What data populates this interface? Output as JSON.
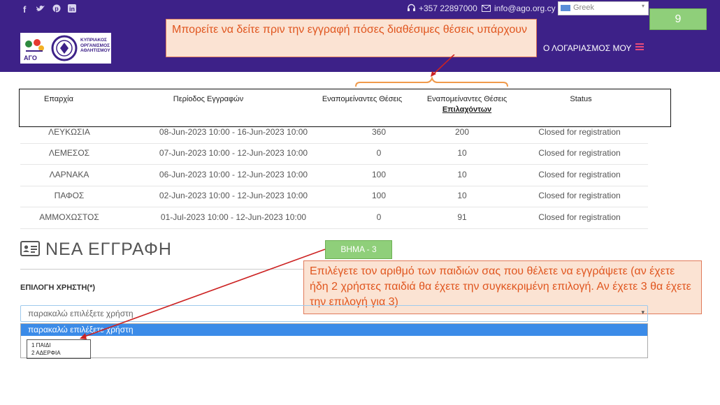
{
  "header": {
    "phone": "+357 22897000",
    "email": "info@ago.org.cy",
    "language": "Greek",
    "account_label": "Ο ΛΟΓΑΡΙΑΣΜΟΣ ΜΟΥ",
    "logo_left_text": "AΓO",
    "logo_right_text": "ΚΥΠΡΙΑΚΟΣ ΟΡΓΑΝΙΣΜΟΣ ΑΘΛΗΤΙΣΜΟΥ"
  },
  "slide_number": "9",
  "callout_top": "Μπορείτε να δείτε πριν την εγγραφή πόσες διαθέσιμες θέσεις υπάρχουν",
  "step_label": "ΒΗΜΑ - 3",
  "callout_step": "Επιλέγετε τον αριθμό των παιδιών σας που θέλετε να εγγράψετε (αν έχετε ήδη 2 χρήστες παιδιά θα έχετε την συγκεκριμένη επιλογή. Αν έχετε 3 θα έχετε την επιλογή για 3)",
  "table": {
    "headers": [
      "Επαρχία",
      "Περίοδος Εγγραφών",
      "Εναπομείναντες Θέσεις",
      "Εναπομείναντες Θέσεις",
      "Επιλαχόντων",
      "Status"
    ],
    "rows": [
      [
        "ΛΕΥΚΩΣΙΑ",
        "08-Jun-2023 10:00 - 16-Jun-2023 10:00",
        "360",
        "200",
        "Closed for registration"
      ],
      [
        "ΛΕΜΕΣΟΣ",
        "07-Jun-2023 10:00 - 12-Jun-2023 10:00",
        "0",
        "10",
        "Closed for registration"
      ],
      [
        "ΛΑΡΝΑΚΑ",
        "06-Jun-2023 10:00 - 12-Jun-2023 10:00",
        "100",
        "10",
        "Closed for registration"
      ],
      [
        "ΠΑΦΟΣ",
        "02-Jun-2023 10:00 - 12-Jun-2023 10:00",
        "100",
        "10",
        "Closed for registration"
      ],
      [
        "ΑΜΜΟΧΩΣΤΟΣ",
        "01-Jul-2023 10:00 - 12-Jun-2023 10:00",
        "0",
        "91",
        "Closed for registration"
      ]
    ]
  },
  "form": {
    "title": "ΝΕΑ ΕΓΓΡΑΦΗ",
    "user_label": "ΕΠΙΛΟΓΗ ΧΡΗΣΤΗ(*)",
    "select_placeholder": "παρακαλώ επιλέξετε χρήστη",
    "options": [
      "παρακαλώ επιλέξετε χρήστη",
      "1 ΠΑΙΔΙ",
      "2 ΑΔΕΡΦΙΑ"
    ]
  },
  "colors": {
    "header_bg": "#3d2188",
    "callout_bg": "#fbe3d3",
    "callout_text": "#e0561f",
    "green": "#8fcf7a",
    "highlight": "#3b8be8"
  },
  "icons": [
    "facebook-icon",
    "twitter-icon",
    "pinterest-icon",
    "linkedin-icon",
    "headset-icon",
    "mail-icon",
    "flag-icon",
    "hamburger-icon",
    "id-card-icon",
    "caret-down-icon"
  ]
}
